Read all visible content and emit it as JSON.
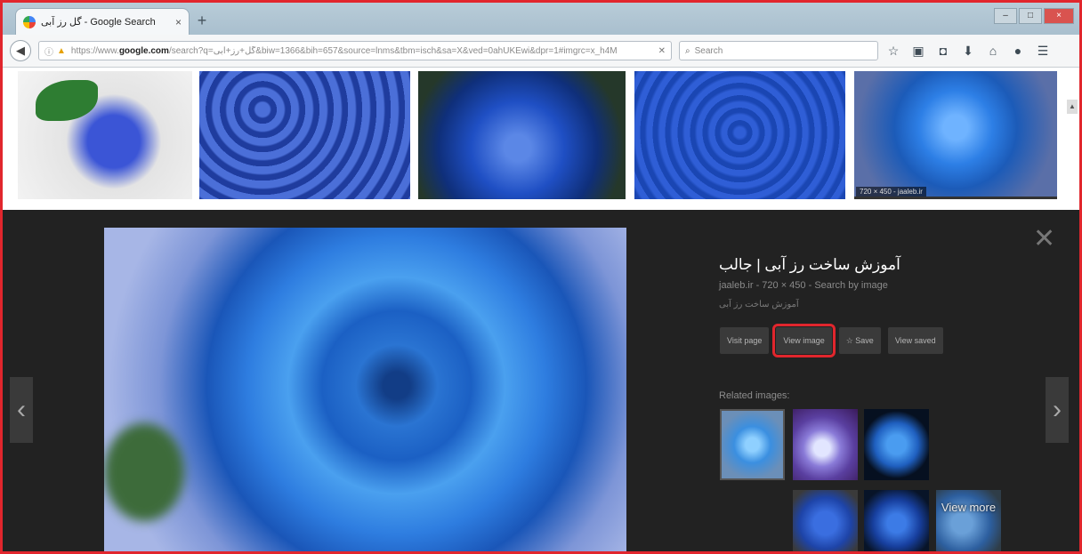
{
  "browser": {
    "tab_title": "گل رز آبی - Google Search",
    "tab_close": "×",
    "new_tab": "+",
    "window_controls": {
      "minimize": "–",
      "maximize": "□",
      "close": "×"
    }
  },
  "navbar": {
    "back_icon": "arrow-left",
    "url_prefix": "https://www.",
    "url_domain": "google.com",
    "url_rest": "/search?q=گل+رز+آبی&biw=1366&bih=657&source=lnms&tbm=isch&sa=X&ved=0ahUKEwi&dpr=1#imgrc=x_h4M",
    "search_placeholder": "Search",
    "toolbar_icons": [
      "bookmark-star-icon",
      "clipboard-icon",
      "pocket-icon",
      "download-icon",
      "home-icon",
      "chat-icon",
      "menu-icon"
    ]
  },
  "thumbnails": {
    "selected_caption": "720 × 450 - jaaleb.ir"
  },
  "preview": {
    "close_label": "✕",
    "prev_label": "‹",
    "next_label": "›",
    "title": "آموزش ساخت رز آبی | جالب",
    "meta": "jaaleb.ir - 720 × 450 - Search by image",
    "description": "آموزش ساخت رز آبی",
    "buttons": {
      "visit_page": "Visit page",
      "view_image": "View image",
      "save": "☆ Save",
      "view_saved": "View saved"
    },
    "related_label": "Related images:",
    "view_more": "View more"
  },
  "colors": {
    "highlight": "#e1262d",
    "panel_background": "#222222"
  }
}
